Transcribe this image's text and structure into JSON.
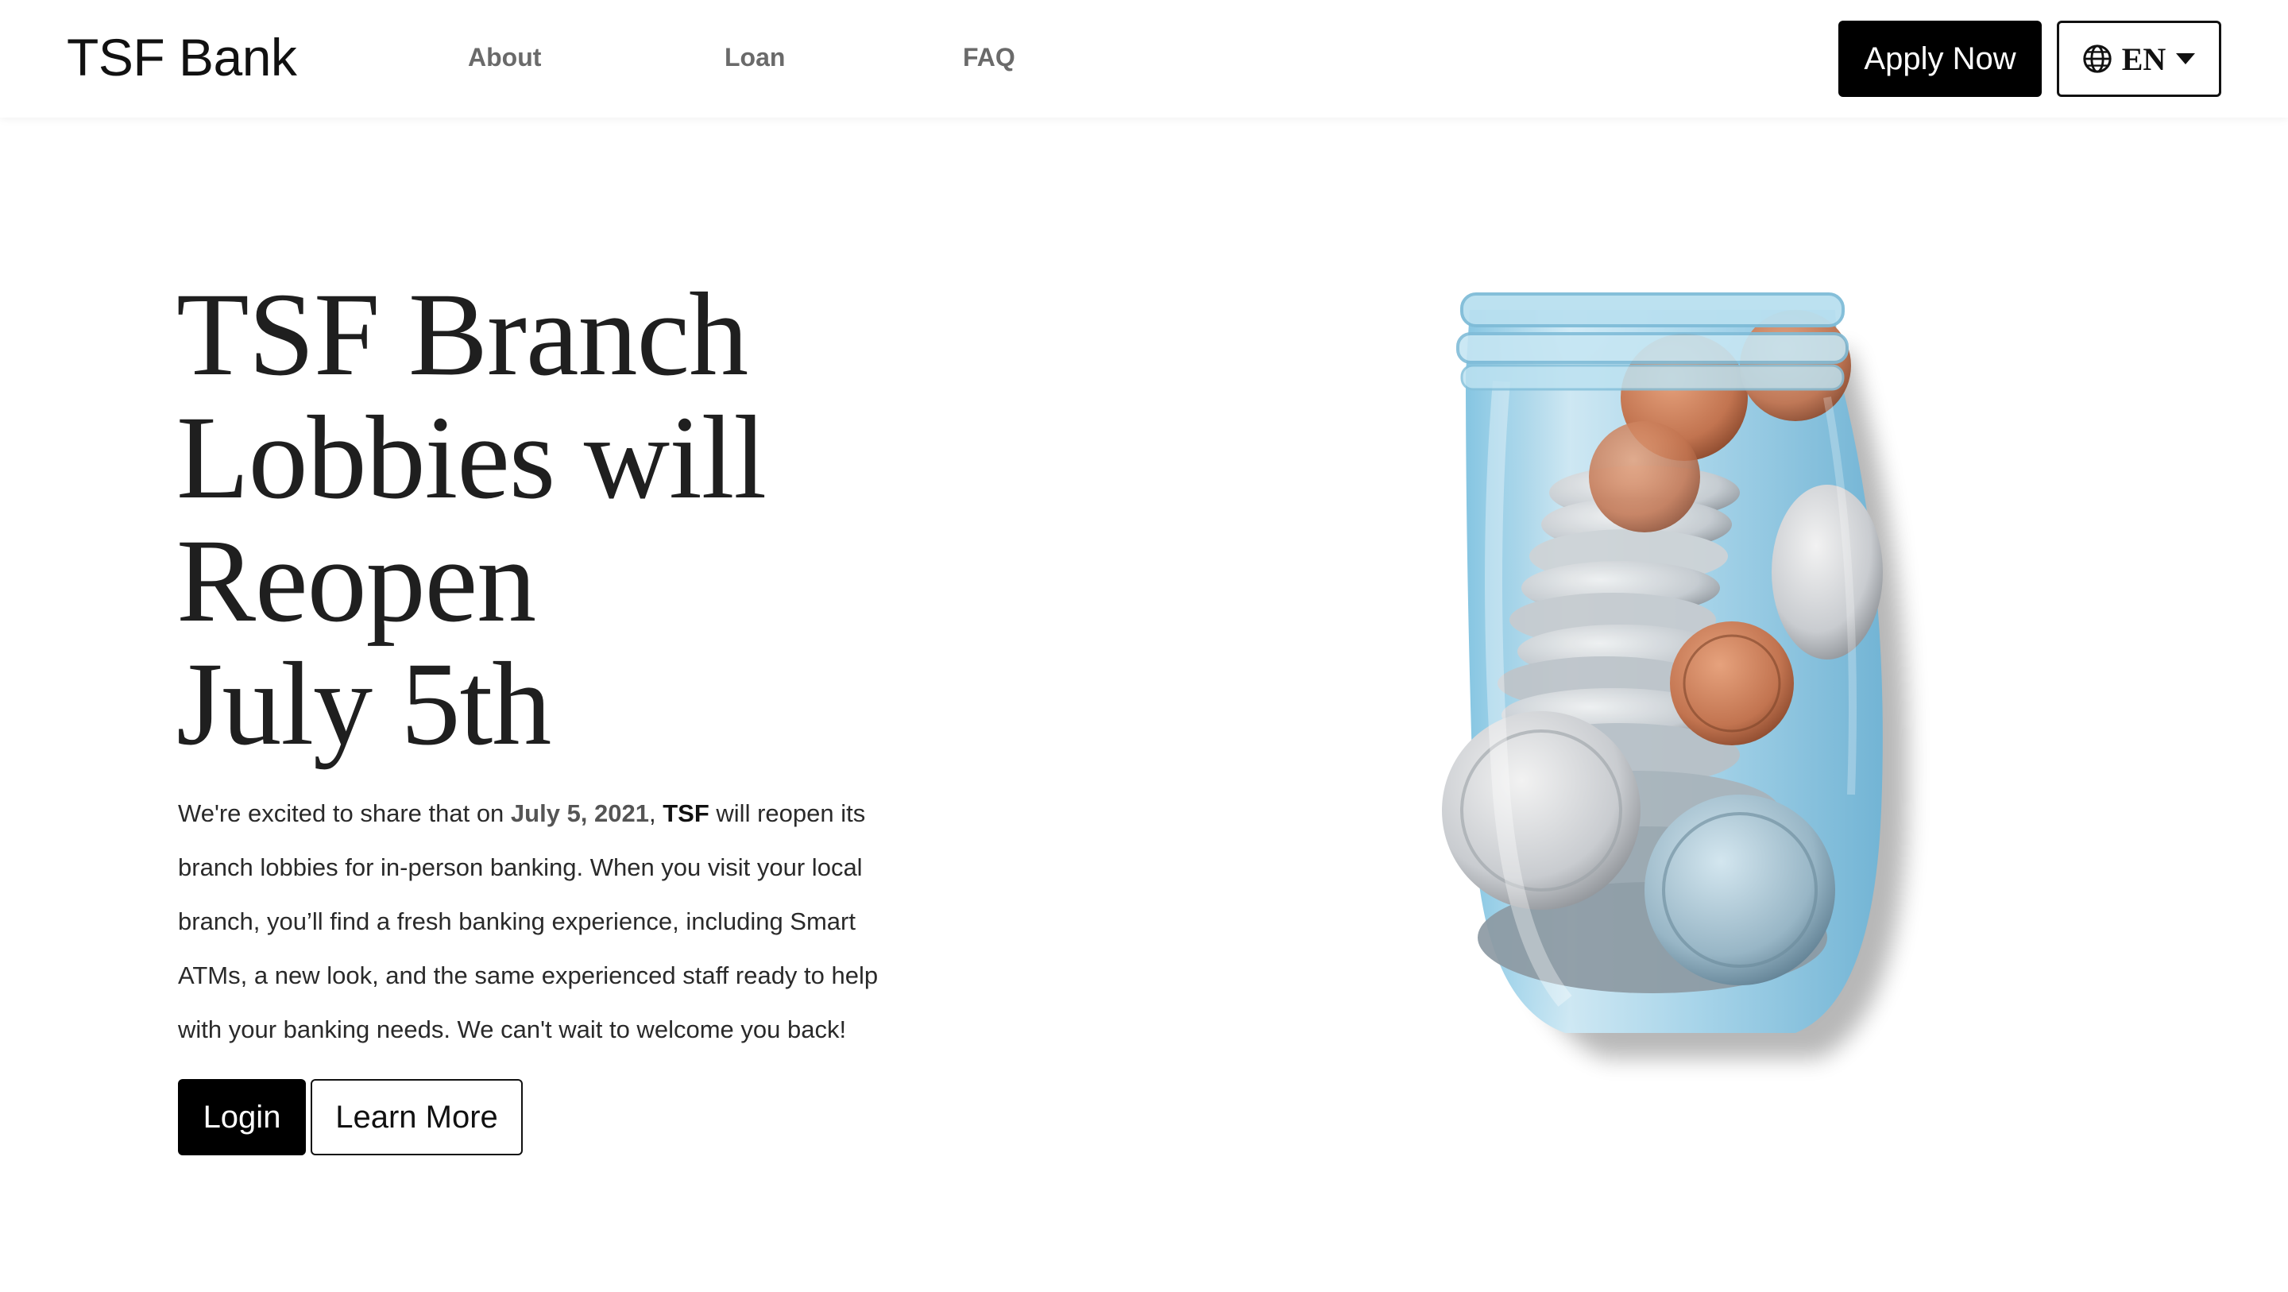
{
  "header": {
    "brand": "TSF Bank",
    "nav": [
      {
        "label": "About"
      },
      {
        "label": "Loan"
      },
      {
        "label": "FAQ"
      }
    ],
    "apply_label": "Apply Now",
    "language": {
      "current": "EN",
      "icon": "globe-icon"
    }
  },
  "hero": {
    "title_lines": [
      "TSF Branch",
      "Lobbies will",
      "Reopen",
      "July 5th"
    ],
    "body_start": "We're excited to share that on ",
    "body_date": "July 5, 2021",
    "body_mid": ", ",
    "body_brand": "TSF",
    "body_rest": " will reopen its branch lobbies for in-person banking. When you visit your local branch, you’ll find a fresh banking experience, including Smart ATMs, a new look, and the same experienced staff ready to help with your banking needs. We can't wait to welcome you back!",
    "login_label": "Login",
    "learn_more_label": "Learn More",
    "image": "coin-jar-image"
  },
  "colors": {
    "primary_button": "#000000",
    "nav_text": "#6a6a6a",
    "jar_glass": "#a9d8ee"
  }
}
